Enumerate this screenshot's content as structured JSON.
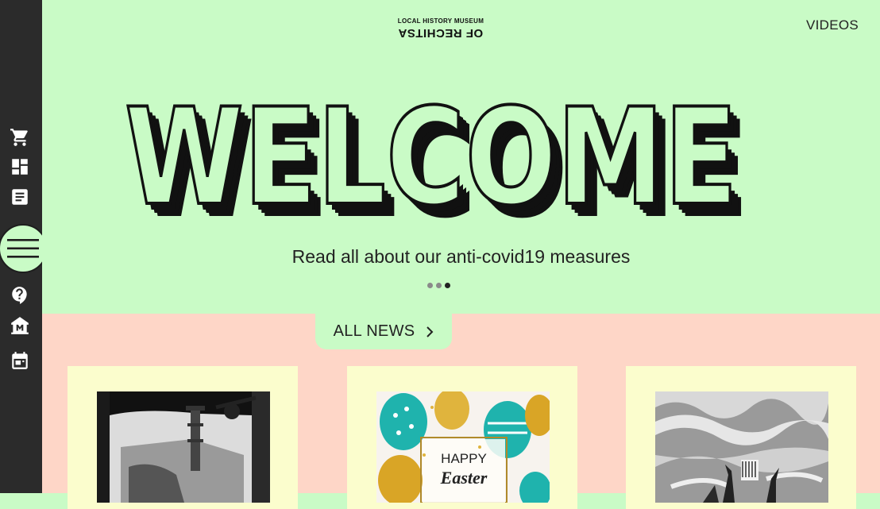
{
  "sidebar": {
    "icons": [
      "cart-icon",
      "dashboard-icon",
      "article-icon",
      "menu-icon",
      "help-icon",
      "museum-icon",
      "calendar-icon"
    ]
  },
  "header": {
    "logo_line1": "LOCAL HISTORY MUSEUM",
    "logo_line2": "OF RECHITSA",
    "videos_label": "VIDEOS"
  },
  "hero": {
    "headline": "WELCOME",
    "subtitle": "Read all about our anti-covid19 measures",
    "slider": {
      "count": 3,
      "active": 3
    }
  },
  "news": {
    "all_news_label": "ALL NEWS",
    "cards": [
      {
        "image": "black-and-white photo of industrial site through window"
      },
      {
        "image": "colorful easter eggs greeting card"
      },
      {
        "image": "black-and-white monument under dramatic sky"
      }
    ],
    "easter_card_text": {
      "happy": "HAPPY",
      "easter": "Easter"
    }
  },
  "colors": {
    "hero_bg": "#c9fbc6",
    "news_bg": "#fed6c7",
    "card_bg": "#fbfdcd",
    "sidebar_bg": "#2b2b2b"
  }
}
